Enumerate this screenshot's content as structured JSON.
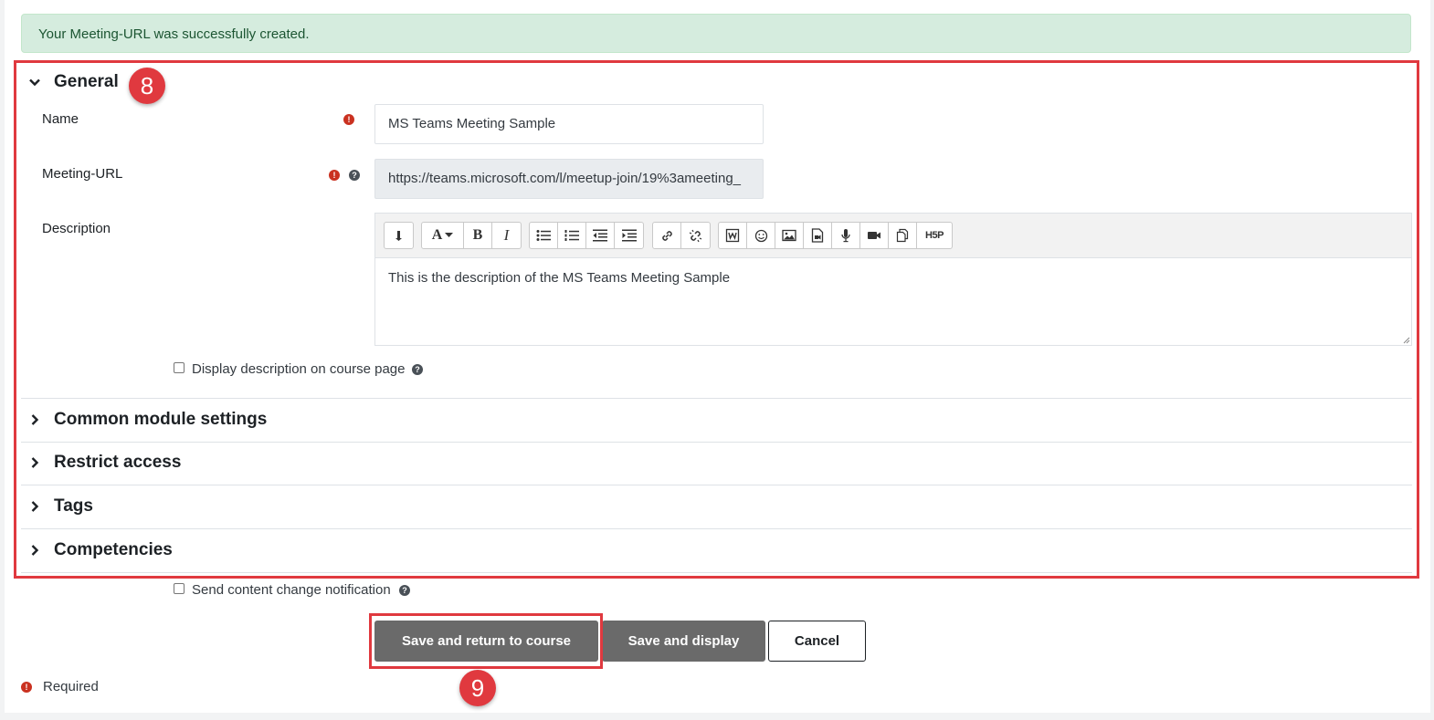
{
  "alert": {
    "text": "Your Meeting-URL was successfully created."
  },
  "annotations": {
    "general_badge": "8",
    "save_badge": "9"
  },
  "general": {
    "title": "General",
    "name_label": "Name",
    "name_value": "MS Teams Meeting Sample",
    "url_label": "Meeting-URL",
    "url_value": "https://teams.microsoft.com/l/meetup-join/19%3ameeting_",
    "description_label": "Description",
    "description_text": "This is the description of the MS Teams Meeting Sample",
    "display_description_label": "Display description on course page"
  },
  "toolbar": {
    "group1": [
      "show-more-buttons-icon"
    ],
    "group2": [
      "font-color-icon",
      "bold-icon",
      "italic-icon"
    ],
    "group3": [
      "unordered-list-icon",
      "ordered-list-icon",
      "outdent-icon",
      "indent-icon"
    ],
    "group4": [
      "link-icon",
      "unlink-icon"
    ],
    "group5": [
      "word-import-icon",
      "emoji-icon",
      "image-icon",
      "media-icon",
      "record-audio-icon",
      "record-video-icon",
      "manage-files-icon",
      "h5p-icon"
    ],
    "bold_glyph": "B",
    "italic_glyph": "I",
    "font_glyph": "A",
    "h5p_glyph": "H5P"
  },
  "sections": [
    {
      "title": "Common module settings"
    },
    {
      "title": "Restrict access"
    },
    {
      "title": "Tags"
    },
    {
      "title": "Competencies"
    }
  ],
  "notification_label": "Send content change notification",
  "buttons": {
    "save_return": "Save and return to course",
    "save_display": "Save and display",
    "cancel": "Cancel"
  },
  "required_label": "Required",
  "colors": {
    "highlight": "#e0393f",
    "alert_bg": "#d5ecde",
    "required_icon": "#ca3120",
    "primary_button": "#6a6a6a"
  }
}
